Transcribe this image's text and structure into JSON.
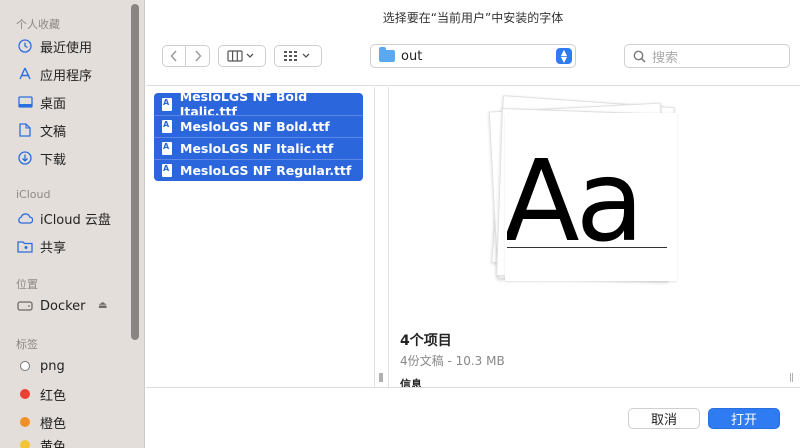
{
  "window": {
    "title": "选择要在“当前用户”中安装的字体"
  },
  "sidebar": {
    "favorites_label": "个人收藏",
    "favorites": [
      {
        "label": "最近使用",
        "icon": "clock-icon"
      },
      {
        "label": "应用程序",
        "icon": "applications-icon"
      },
      {
        "label": "桌面",
        "icon": "desktop-icon"
      },
      {
        "label": "文稿",
        "icon": "document-icon"
      },
      {
        "label": "下载",
        "icon": "download-icon"
      }
    ],
    "icloud_label": "iCloud",
    "icloud": [
      {
        "label": "iCloud 云盘",
        "icon": "cloud-icon"
      },
      {
        "label": "共享",
        "icon": "shared-folder-icon"
      }
    ],
    "locations_label": "位置",
    "locations": [
      {
        "label": "Docker",
        "icon": "disk-icon"
      }
    ],
    "tags_label": "标签",
    "tags": [
      {
        "label": "png",
        "color": "#ffffff"
      },
      {
        "label": "红色",
        "color": "#ec4034"
      },
      {
        "label": "橙色",
        "color": "#f0902a"
      },
      {
        "label": "黄色",
        "color": "#f2c633"
      }
    ]
  },
  "toolbar": {
    "path": "out",
    "search_placeholder": "搜索"
  },
  "files": [
    {
      "name": "MesloLGS NF Bold Italic.ttf"
    },
    {
      "name": "MesloLGS NF Bold.ttf"
    },
    {
      "name": "MesloLGS NF Italic.ttf"
    },
    {
      "name": "MesloLGS NF Regular.ttf"
    }
  ],
  "preview": {
    "glyph": "Aa",
    "count": "4个项目",
    "meta": "4份文稿 - 10.3 MB",
    "info_label": "信息"
  },
  "footer": {
    "cancel_label": "取消",
    "open_label": "打开"
  },
  "colors": {
    "accent": "#2f7bf2",
    "selection": "#2b66dd",
    "sidebar_bg": "#e4dedb"
  }
}
